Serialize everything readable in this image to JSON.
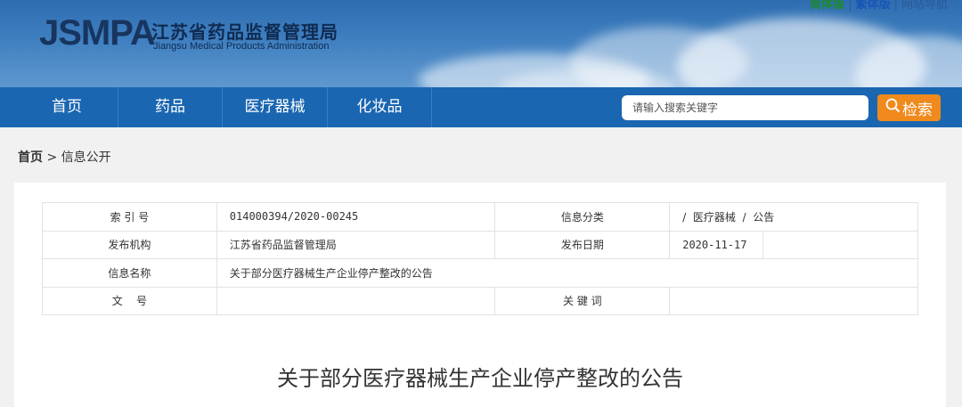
{
  "header": {
    "logo_wordmark": "JSMPA",
    "logo_cn": "江苏省药品监督管理局",
    "logo_en": "Jiangsu Medical Products Administration",
    "links": [
      {
        "label": "简体版",
        "color": "#1d8a2a"
      },
      {
        "label": "繁体版",
        "color": "#1a55b8"
      },
      {
        "label": "网站导航",
        "color": "#1a55b8"
      }
    ],
    "link_separator": "|"
  },
  "nav": {
    "items": [
      {
        "label": "首页"
      },
      {
        "label": "药品"
      },
      {
        "label": "医疗器械"
      },
      {
        "label": "化妆品"
      }
    ],
    "search_placeholder": "请输入搜索关键字",
    "search_button": "检索"
  },
  "breadcrumb": {
    "home": "首页",
    "separator": ">",
    "current": "信息公开"
  },
  "meta": {
    "index_label": "索 引 号",
    "index_value": "014000394/2020-00245",
    "category_label": "信息分类",
    "category_value": "/  医疗器械  /  公告",
    "publisher_label": "发布机构",
    "publisher_value": "江苏省药品监督管理局",
    "date_label": "发布日期",
    "date_value": "2020-11-17",
    "name_label": "信息名称",
    "name_value": "关于部分医疗器械生产企业停产整改的公告",
    "docno_label": "文    号",
    "docno_value": "",
    "keywords_label": "关 键 词",
    "keywords_value": ""
  },
  "article": {
    "title": "关于部分医疗器械生产企业停产整改的公告"
  },
  "colors": {
    "nav_bg": "#1a66b1",
    "search_button": "#f08a1c"
  }
}
